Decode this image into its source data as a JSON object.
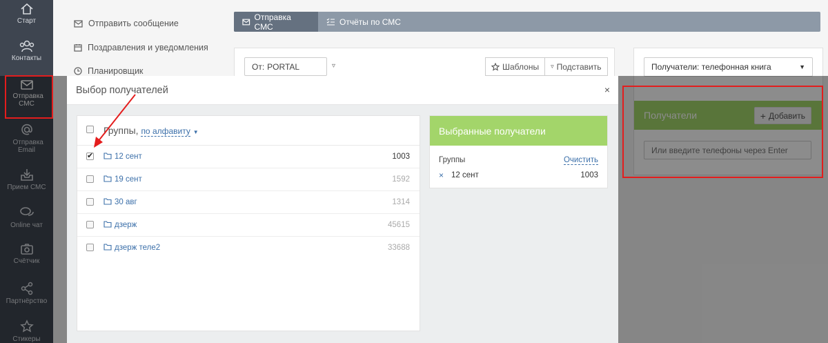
{
  "sidebar": {
    "items": [
      {
        "label": "Старт",
        "icon": "home-icon"
      },
      {
        "label": "Контакты",
        "icon": "contacts-icon"
      },
      {
        "label": "Отправка СМС",
        "icon": "envelope-icon"
      },
      {
        "label": "Отправка Email",
        "icon": "at-icon"
      },
      {
        "label": "Прием СМС",
        "icon": "inbox-icon"
      },
      {
        "label": "Online чат",
        "icon": "chat-icon"
      },
      {
        "label": "Счётчик",
        "icon": "camera-icon"
      },
      {
        "label": "Партнёрство",
        "icon": "share-icon"
      },
      {
        "label": "Стикеры",
        "icon": "star-icon"
      }
    ]
  },
  "submenu": {
    "items": [
      {
        "label": "Отправить сообщение",
        "icon": "envelope-icon"
      },
      {
        "label": "Поздравления и уведомления",
        "icon": "calendar-icon"
      },
      {
        "label": "Планировщик",
        "icon": "clock-icon"
      }
    ]
  },
  "tabs": [
    {
      "label": "Отправка СМС",
      "active": true
    },
    {
      "label": "Отчёты по СМС",
      "active": false
    }
  ],
  "compose": {
    "from_prefix": "От:",
    "from_value": "PORTAL",
    "templates_label": "Шаблоны",
    "insert_label": "Подставить"
  },
  "recipients": {
    "source_select": "Получатели: телефонная книга",
    "title": "Получатели",
    "add_label": "Добавить",
    "phone_placeholder": "Или введите телефоны через Enter"
  },
  "modal": {
    "title": "Выбор получателей",
    "close": "×",
    "groups_label": "Группы,",
    "sort_label": "по алфавиту",
    "rows": [
      {
        "name": "12 сент",
        "count": "1003",
        "checked": true
      },
      {
        "name": "19 сент",
        "count": "1592",
        "checked": false
      },
      {
        "name": "30 авг",
        "count": "1314",
        "checked": false
      },
      {
        "name": "дзерж",
        "count": "45615",
        "checked": false
      },
      {
        "name": "дзерж теле2",
        "count": "33688",
        "checked": false
      }
    ],
    "selected": {
      "title": "Выбранные получатели",
      "groups_label": "Группы",
      "clear_label": "Очистить",
      "remove_glyph": "×",
      "item_name": "12 сент",
      "item_count": "1003"
    }
  },
  "colors": {
    "sidebar_bg": "#3e4550",
    "accent_green": "#a3d56a",
    "tab_bg": "#8d99a7",
    "link_blue": "#3b6fa9",
    "annotation_red": "#e41d1d"
  }
}
